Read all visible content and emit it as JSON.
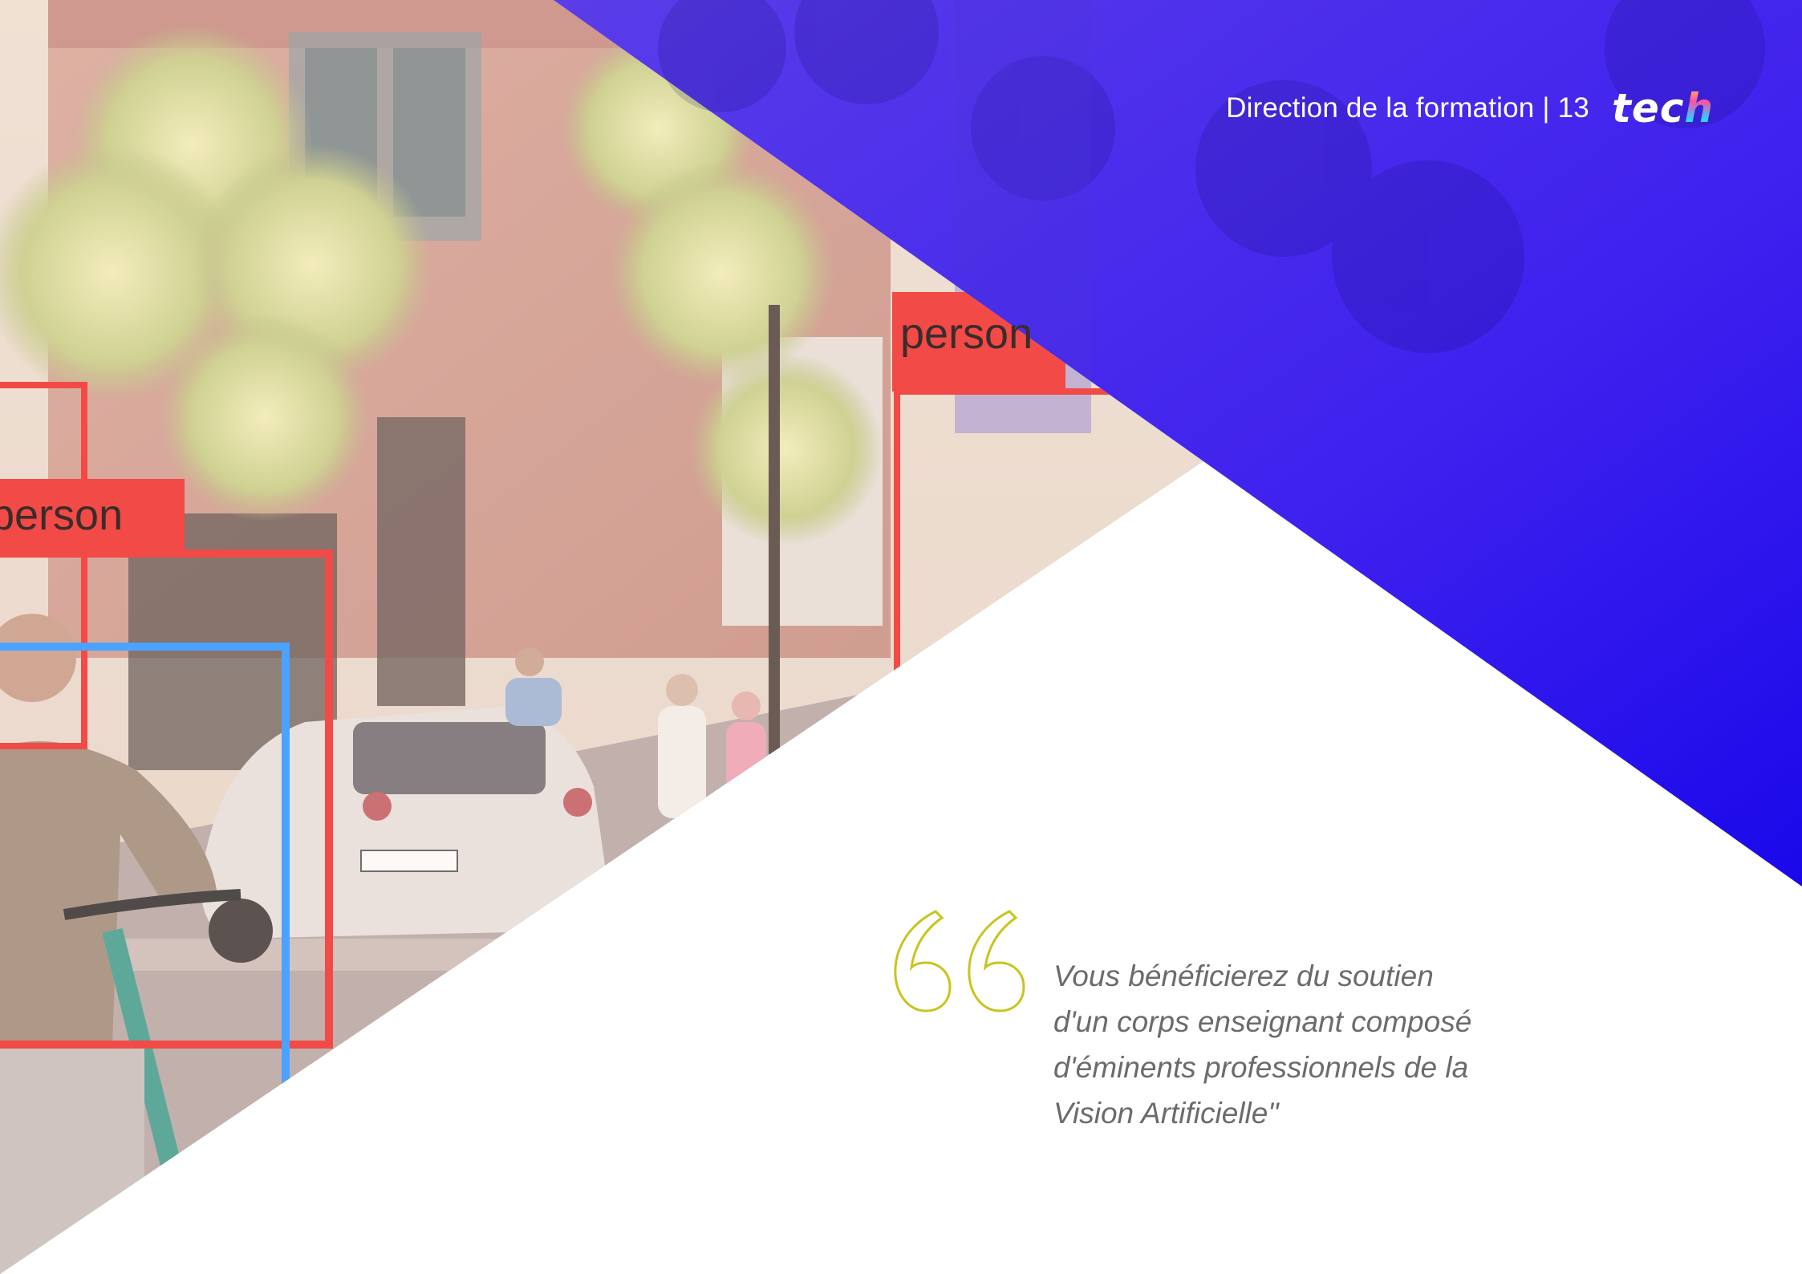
{
  "header": {
    "section_title": "Direction de la formation | 13",
    "logo_text": "tec",
    "logo_last_letter": "h"
  },
  "background_photo": {
    "detections": [
      {
        "label": "person",
        "color": "#f24a46"
      },
      {
        "label": "person",
        "color": "#f24a46"
      },
      {
        "label": "",
        "color": "#f24a46"
      },
      {
        "label": "",
        "color": "#4aa3ff"
      }
    ]
  },
  "quote": {
    "icon": "quote-open-icon",
    "icon_color": "#c9c41e",
    "text": "Vous bénéficierez du soutien\nd'un corps enseignant composé\nd'éminents professionnels de la\nVision Artificielle\""
  },
  "colors": {
    "accent_purple": "#3a1df0",
    "accent_blue": "#1a0be8",
    "photo_tint": "#e8c7b8"
  }
}
